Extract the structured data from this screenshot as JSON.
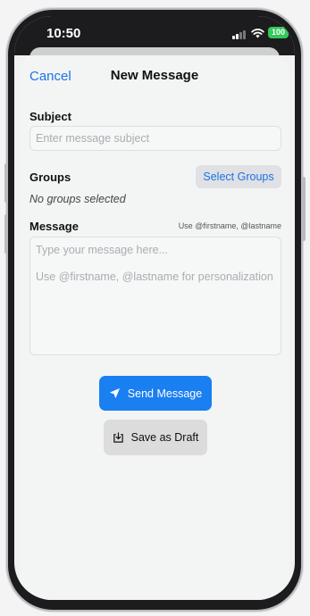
{
  "status_bar": {
    "time": "10:50",
    "battery": "100",
    "battery_color": "#34c759"
  },
  "nav": {
    "cancel_label": "Cancel",
    "title": "New Message"
  },
  "subject": {
    "label": "Subject",
    "placeholder": "Enter message subject"
  },
  "groups": {
    "label": "Groups",
    "select_label": "Select Groups",
    "empty_text": "No groups selected"
  },
  "message": {
    "label": "Message",
    "hint": "Use @firstname, @lastname",
    "placeholder_line1": "Type your message here...",
    "placeholder_line2": "Use @firstname, @lastname for personalization"
  },
  "actions": {
    "send_label": "Send Message",
    "send_icon": "paper-plane-icon",
    "draft_label": "Save as Draft",
    "draft_icon": "save-tray-icon",
    "accent_color": "#1a7ff0"
  }
}
